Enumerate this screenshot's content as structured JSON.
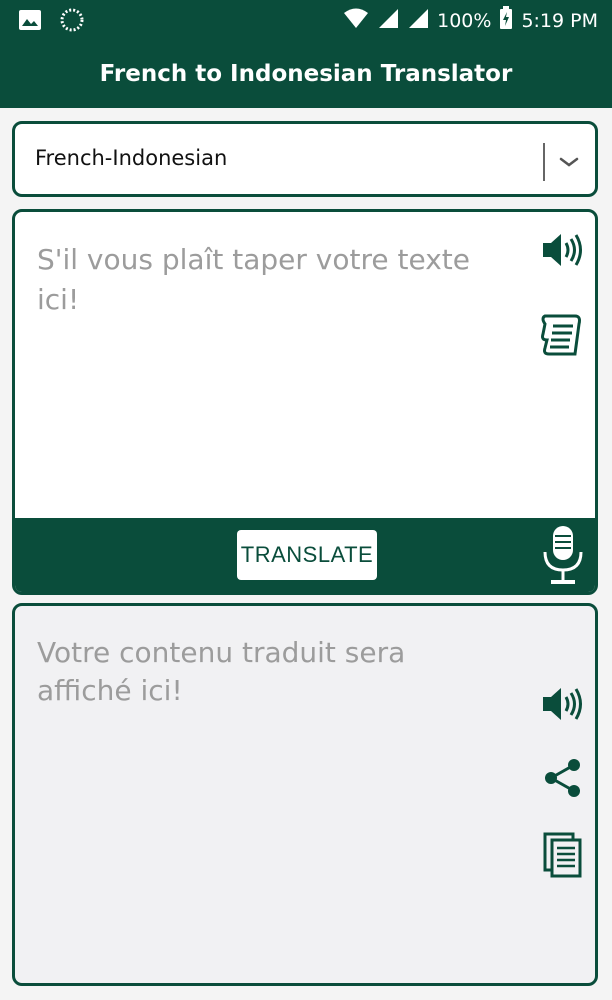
{
  "status_bar": {
    "battery": "100%",
    "time": "5:19 PM",
    "icons": [
      "image-icon",
      "app-loading-icon",
      "wifi-icon",
      "signal-icon",
      "signal-icon-2",
      "battery-charging-icon"
    ]
  },
  "app_bar": {
    "title": "French to Indonesian Translator"
  },
  "language_selector": {
    "selected": "French-Indonesian",
    "icon": "chevron-down-icon"
  },
  "input": {
    "placeholder": "S'il vous plaît taper votre texte ici!",
    "icons": [
      "speaker-icon",
      "scroll-paste-icon",
      "microphone-icon"
    ]
  },
  "actions": {
    "translate_label": "TRANSLATE"
  },
  "output": {
    "placeholder": "Votre contenu traduit sera affiché ici!",
    "icons": [
      "speaker-icon",
      "share-icon",
      "copy-icon"
    ]
  },
  "colors": {
    "primary": "#0a4d3b",
    "placeholder_text": "#9c9c9c",
    "output_background": "#f1f1f3"
  }
}
